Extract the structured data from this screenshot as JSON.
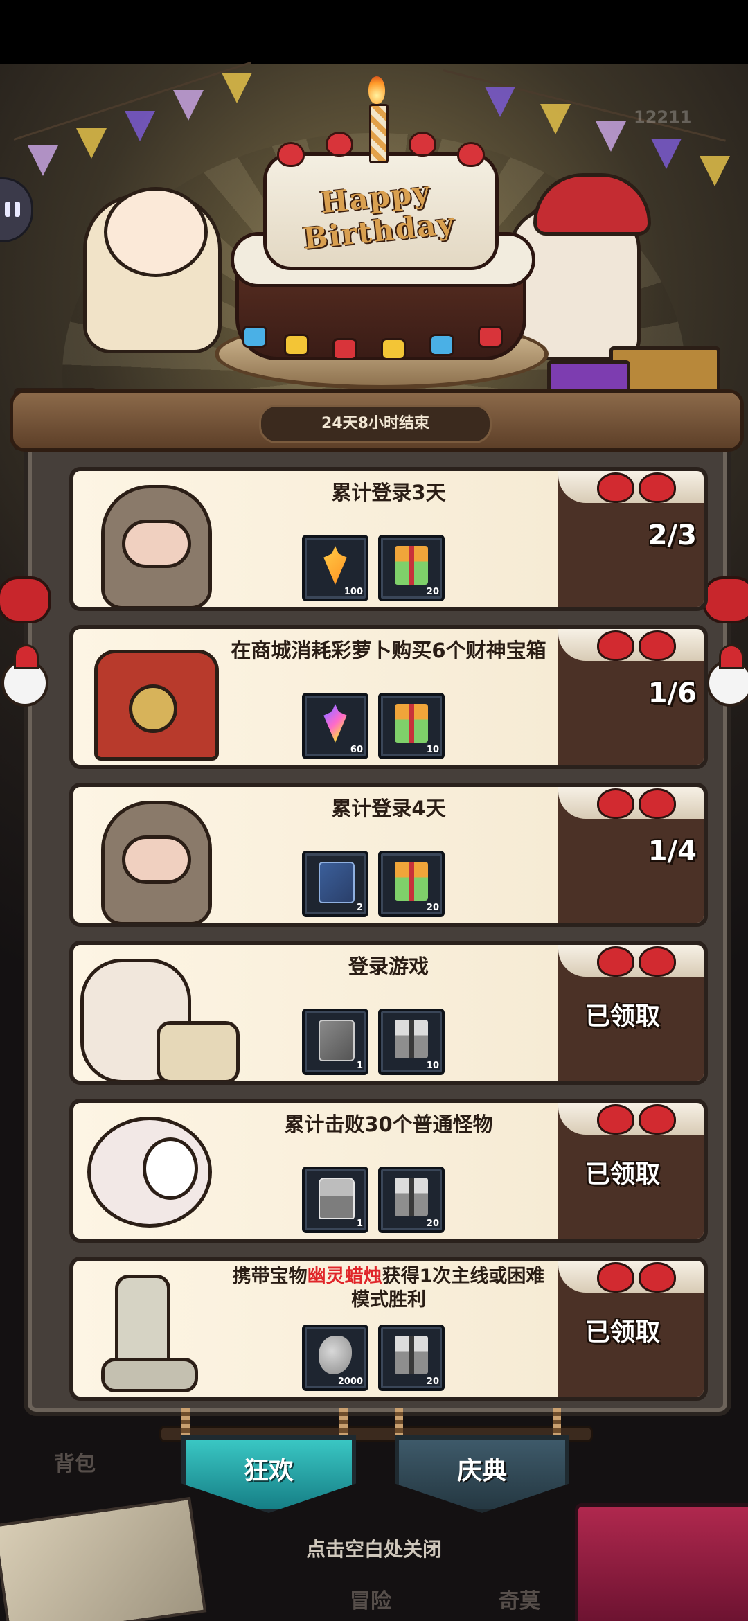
{
  "background": {
    "score": "12211",
    "cake_text": "Happy Birthday"
  },
  "timer": "24天8小时结束",
  "tasks": [
    {
      "title": "累计登录3天",
      "title_parts": [],
      "progress": "2/3",
      "claimed": "",
      "rewards": [
        {
          "icon": "carrot-icon",
          "qty": "100"
        },
        {
          "icon": "gift-box-icon",
          "qty": "20"
        }
      ],
      "art": "hippo-costume"
    },
    {
      "title": "在商城消耗彩萝卜购买6个财神宝箱",
      "title_parts": [],
      "progress": "1/6",
      "claimed": "",
      "rewards": [
        {
          "icon": "rainbow-carrot-icon",
          "qty": "60"
        },
        {
          "icon": "gift-box-icon",
          "qty": "10"
        }
      ],
      "art": "treasure-chest"
    },
    {
      "title": "累计登录4天",
      "title_parts": [],
      "progress": "1/4",
      "claimed": "",
      "rewards": [
        {
          "icon": "blue-scroll-icon",
          "qty": "2"
        },
        {
          "icon": "gift-box-icon",
          "qty": "20"
        }
      ],
      "art": "hippo-costume"
    },
    {
      "title": "登录游戏",
      "title_parts": [],
      "progress": "",
      "claimed": "已领取",
      "rewards": [
        {
          "icon": "grey-scroll-icon",
          "qty": "1"
        },
        {
          "icon": "grey-gift-box-icon",
          "qty": "10"
        }
      ],
      "art": "rabbit-with-cake"
    },
    {
      "title": "累计击败30个普通怪物",
      "title_parts": [],
      "progress": "",
      "claimed": "已领取",
      "rewards": [
        {
          "icon": "silver-chest-icon",
          "qty": "1"
        },
        {
          "icon": "grey-gift-box-icon",
          "qty": "20"
        }
      ],
      "art": "ghost-blob"
    },
    {
      "title": "",
      "title_parts": [
        "携带宝物",
        "幽灵蜡烛",
        "获得1次主线或困难",
        "模式胜利"
      ],
      "progress": "",
      "claimed": "已领取",
      "rewards": [
        {
          "icon": "stone-icon",
          "qty": "2000"
        },
        {
          "icon": "grey-gift-box-icon",
          "qty": "20"
        }
      ],
      "art": "ghost-candle"
    }
  ],
  "tabs": {
    "carnival": "狂欢",
    "festival": "庆典"
  },
  "close_hint": "点击空白处关闭",
  "bottom_nav": {
    "bag": "背包",
    "adventure": "冒险",
    "wonder": "奇莫"
  },
  "colors": {
    "highlight": "#e0262a",
    "active_tab": "#2aa6a8",
    "panel": "#463f3a"
  }
}
